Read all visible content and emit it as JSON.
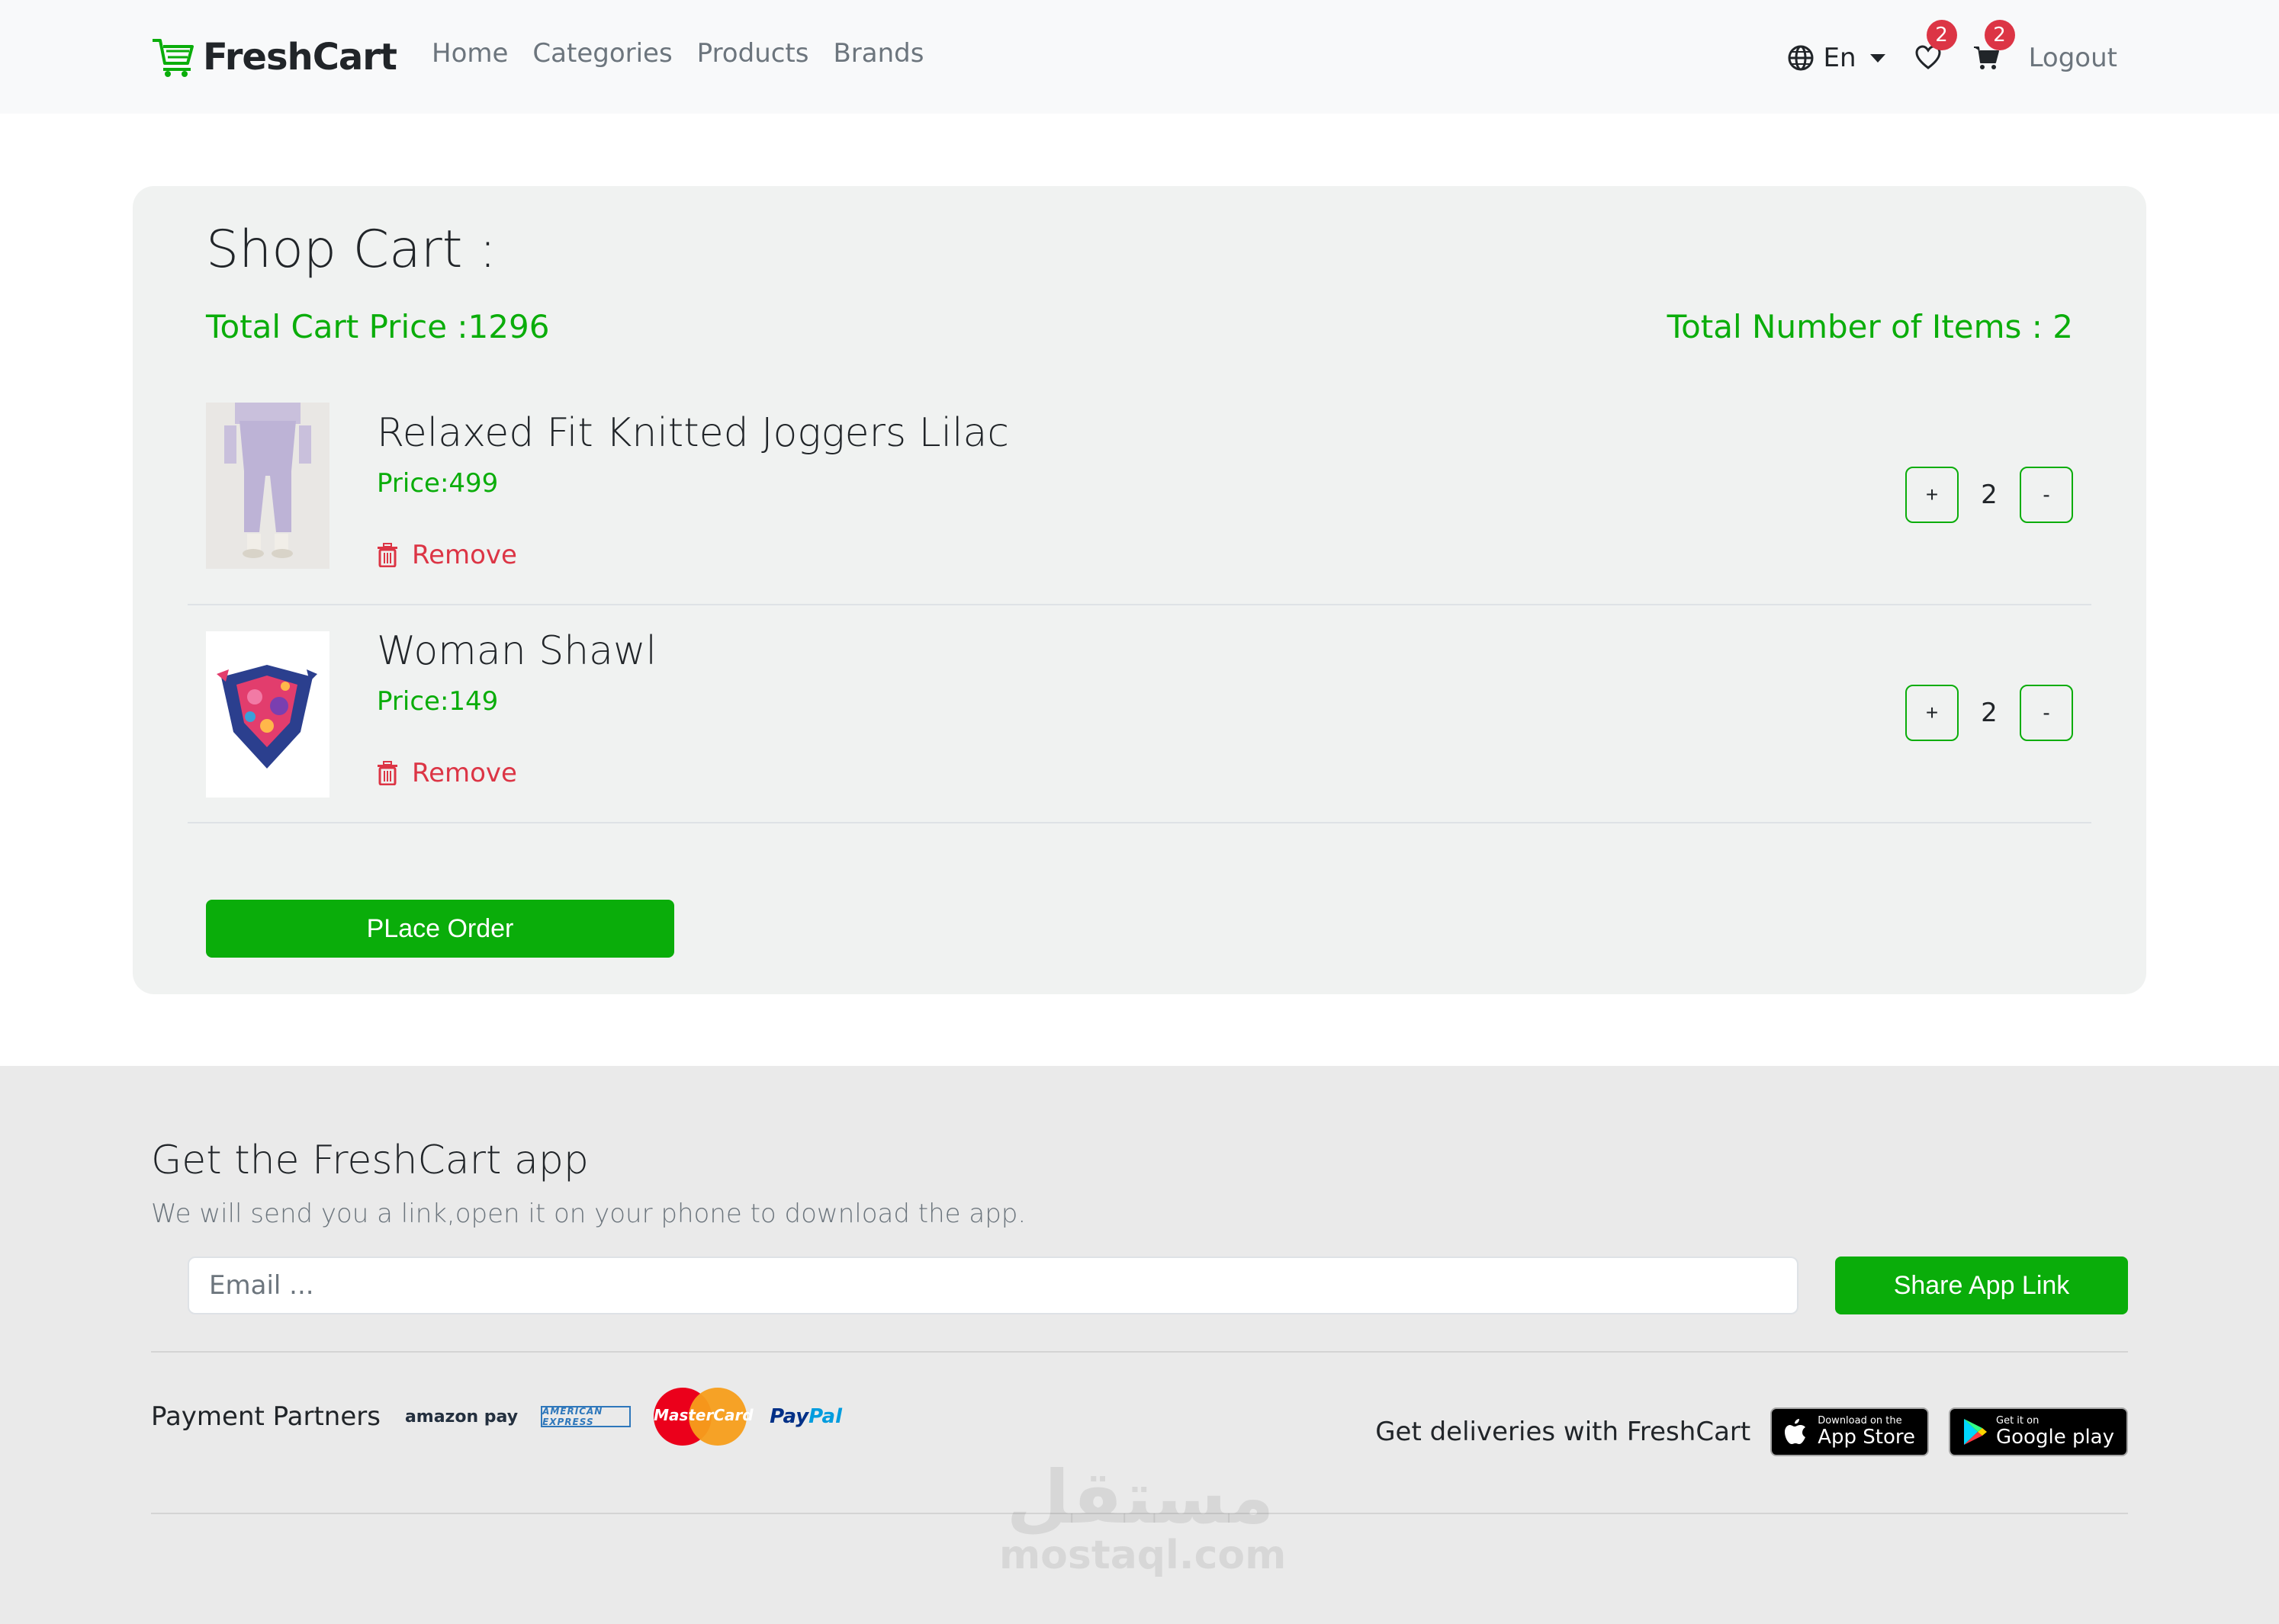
{
  "colors": {
    "accent": "#0aad0a",
    "danger": "#dc3545",
    "navbar_bg": "#f8f9fa",
    "card_bg": "#f0f2f1",
    "footer_bg": "#eaeaea"
  },
  "navbar": {
    "brand": "FreshCart",
    "brand_icon": "cart-logo-icon",
    "links": [
      "Home",
      "Categories",
      "Products",
      "Brands"
    ],
    "language": "En",
    "wishlist_count": "2",
    "cart_count": "2",
    "logout": "Logout"
  },
  "cart": {
    "title": "Shop Cart :",
    "total_price": "Total Cart Price :1296",
    "total_items": "Total Number of Items : 2",
    "items": [
      {
        "name": "Relaxed Fit Knitted Joggers Lilac",
        "price": "Price:499",
        "remove": "Remove",
        "quantity": "2",
        "plus": "+",
        "minus": "-"
      },
      {
        "name": "Woman Shawl",
        "price": "Price:149",
        "remove": "Remove",
        "quantity": "2",
        "plus": "+",
        "minus": "-"
      }
    ],
    "place_order": "PLace Order"
  },
  "footer": {
    "title": "Get the FreshCart app",
    "subtitle": "We will send you a link,open it on your phone to download the app.",
    "email_placeholder": "Email ...",
    "share_button": "Share App Link",
    "payment_label": "Payment Partners",
    "partners": {
      "amazon": "amazon pay",
      "amex": "AMERICAN EXPRESS",
      "mastercard": "MasterCard",
      "paypal_a": "Pay",
      "paypal_b": "Pal"
    },
    "deliveries_label": "Get deliveries with FreshCart",
    "app_store_small": "Download on the",
    "app_store_big": "App Store",
    "google_small": "Get it on",
    "google_big": "Google play"
  },
  "watermark": {
    "ar": "مستقل",
    "en": "mostaql.com"
  }
}
